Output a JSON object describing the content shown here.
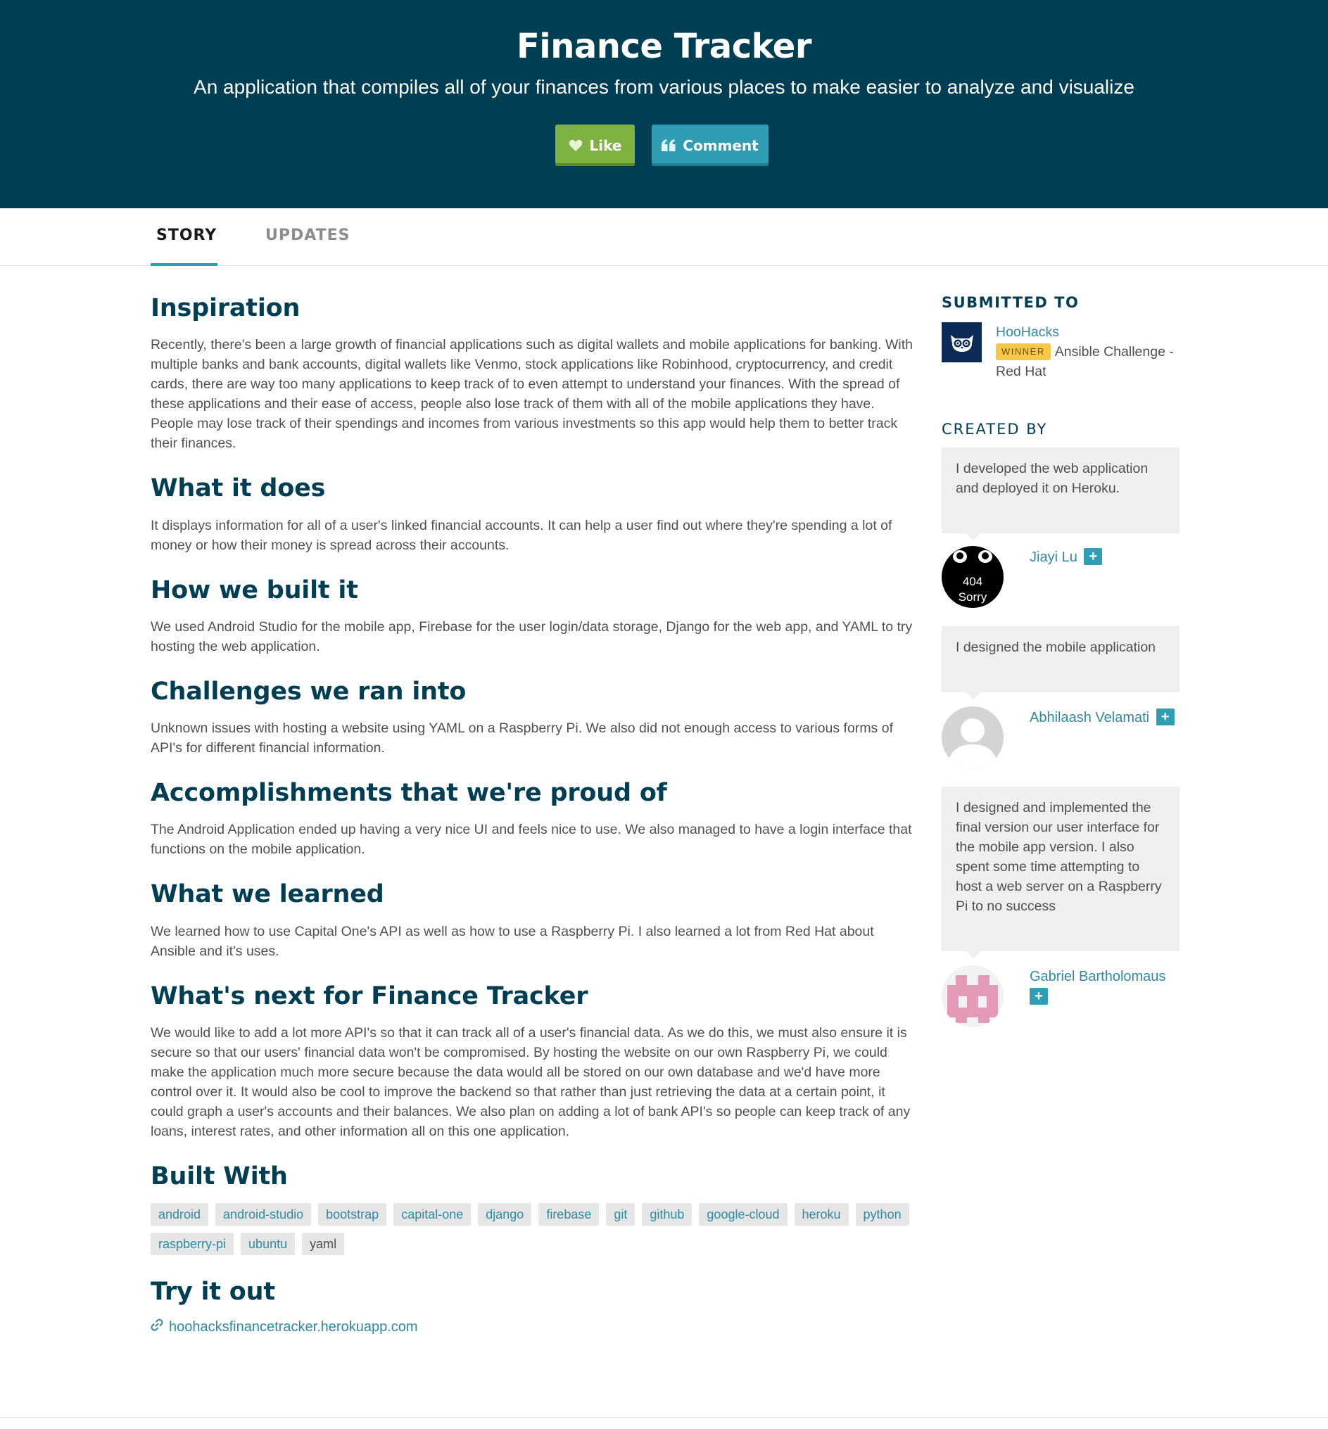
{
  "header": {
    "title": "Finance Tracker",
    "tagline": "An application that compiles all of your finances from various places to make easier to analyze and visualize",
    "like_label": "Like",
    "comment_label": "Comment"
  },
  "tabs": [
    {
      "label": "STORY",
      "active": true
    },
    {
      "label": "UPDATES",
      "active": false
    }
  ],
  "sections": [
    {
      "heading": "Inspiration",
      "body": "Recently, there's been a large growth of financial applications such as digital wallets and mobile applications for banking. With multiple banks and bank accounts, digital wallets like Venmo, stock applications like Robinhood, cryptocurrency, and credit cards, there are way too many applications to keep track of to even attempt to understand your finances. With the spread of these applications and their ease of access, people also lose track of them with all of the mobile applications they have. People may lose track of their spendings and incomes from various investments so this app would help them to better track their finances."
    },
    {
      "heading": "What it does",
      "body": "It displays information for all of a user's linked financial accounts. It can help a user find out where they're spending a lot of money or how their money is spread across their accounts."
    },
    {
      "heading": "How we built it",
      "body": "We used Android Studio for the mobile app, Firebase for the user login/data storage, Django for the web app, and YAML to try hosting the web application."
    },
    {
      "heading": "Challenges we ran into",
      "body": "Unknown issues with hosting a website using YAML on a Raspberry Pi. We also did not enough access to various forms of API's for different financial information."
    },
    {
      "heading": "Accomplishments that we're proud of",
      "body": "The Android Application ended up having a very nice UI and feels nice to use. We also managed to have a login interface that functions on the mobile application."
    },
    {
      "heading": "What we learned",
      "body": "We learned how to use Capital One's API as well as how to use a Raspberry Pi. I also learned a lot from Red Hat about Ansible and it's uses."
    },
    {
      "heading": "What's next for Finance Tracker",
      "body": "We would like to add a lot more API's so that it can track all of a user's financial data. As we do this, we must also ensure it is secure so that our users' financial data won't be compromised. By hosting the website on our own Raspberry Pi, we could make the application much more secure because the data would all be stored on our own database and we'd have more control over it. It would also be cool to improve the backend so that rather than just retrieving the data at a certain point, it could graph a user's accounts and their balances. We also plan on adding a lot of bank API's so people can keep track of any loans, interest rates, and other information all on this one application."
    }
  ],
  "built_with": {
    "heading": "Built With",
    "tags": [
      "android",
      "android-studio",
      "bootstrap",
      "capital-one",
      "django",
      "firebase",
      "git",
      "github",
      "google-cloud",
      "heroku",
      "python",
      "raspberry-pi",
      "ubuntu",
      "yaml"
    ]
  },
  "try_it_out": {
    "heading": "Try it out",
    "link": "hoohacksfinancetracker.herokuapp.com"
  },
  "sidebar": {
    "submitted_heading": "SUBMITTED TO",
    "hackathon": "HooHacks",
    "winner_badge": "WINNER",
    "prize": "Ansible Challenge - Red Hat",
    "created_heading": "CREATED BY",
    "members": [
      {
        "bio": "I developed the web application and deployed it on Heroku.",
        "name": "Jiayi Lu",
        "avatar_text": [
          "404",
          "Sorry"
        ]
      },
      {
        "bio": "I designed the mobile application",
        "name": "Abhilaash Velamati"
      },
      {
        "bio": "I designed and implemented the final version our user interface for the mobile app version. I also spent some time attempting to host a web server on a Raspberry Pi to no success",
        "name": "Gabriel Bartholomaus"
      }
    ],
    "follow_glyph": "+"
  },
  "colors": {
    "header_bg": "#003e54",
    "like": "#7fb341",
    "comment": "#2f9db3",
    "link": "#2f8aa1",
    "winner": "#f6c845"
  }
}
